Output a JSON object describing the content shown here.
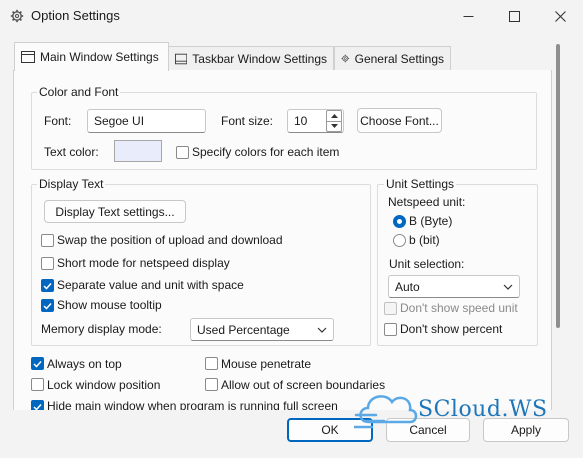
{
  "window": {
    "title": "Option Settings",
    "icons": {
      "app": "gear-icon",
      "minimize": "minimize-icon",
      "maximize": "maximize-icon",
      "close": "close-icon"
    }
  },
  "tabs": [
    {
      "label": "Main Window Settings",
      "icon": "window-icon",
      "active": true
    },
    {
      "label": "Taskbar Window Settings",
      "icon": "taskbar-icon",
      "active": false
    },
    {
      "label": "General Settings",
      "icon": "gear-icon",
      "active": false
    }
  ],
  "color_font": {
    "title": "Color and Font",
    "font_label": "Font:",
    "font_value": "Segoe UI",
    "font_size_label": "Font size:",
    "font_size_value": "10",
    "choose_font_label": "Choose Font...",
    "text_color_label": "Text color:",
    "text_color_swatch": "#e9ecfb",
    "specify_colors_label": "Specify colors for each item",
    "specify_colors_checked": false
  },
  "display_text": {
    "title": "Display Text",
    "settings_button": "Display Text settings...",
    "options": [
      {
        "label": "Swap the position of upload and download",
        "checked": false
      },
      {
        "label": "Short mode for netspeed display",
        "checked": false
      },
      {
        "label": "Separate value and unit with space",
        "checked": true
      },
      {
        "label": "Show mouse tooltip",
        "checked": true
      }
    ],
    "memory_mode_label": "Memory display mode:",
    "memory_mode_value": "Used Percentage"
  },
  "unit_settings": {
    "title": "Unit Settings",
    "netspeed_unit_label": "Netspeed unit:",
    "unit_options": [
      {
        "label": "B (Byte)",
        "selected": true
      },
      {
        "label": "b (bit)",
        "selected": false
      }
    ],
    "unit_selection_label": "Unit selection:",
    "unit_selection_value": "Auto",
    "dont_show_speed_unit": {
      "label": "Don't show speed unit",
      "checked": false,
      "enabled": false
    },
    "dont_show_percent": {
      "label": "Don't show percent",
      "checked": false
    }
  },
  "window_options": {
    "always_on_top": {
      "label": "Always on top",
      "checked": true
    },
    "mouse_penetrate": {
      "label": "Mouse penetrate",
      "checked": false
    },
    "lock_position": {
      "label": "Lock window position",
      "checked": false
    },
    "out_of_bounds": {
      "label": "Allow out of screen boundaries",
      "checked": false
    },
    "hide_fullscreen": {
      "label": "Hide main window when program is running full screen",
      "checked": true
    }
  },
  "footer": {
    "ok": "OK",
    "cancel": "Cancel",
    "apply": "Apply"
  },
  "watermark": {
    "text": "SCloud.WS",
    "icon": "cloud-icon"
  },
  "colors": {
    "accent": "#0067c0",
    "background": "#f3f3f3",
    "page": "#fbfbfb"
  }
}
